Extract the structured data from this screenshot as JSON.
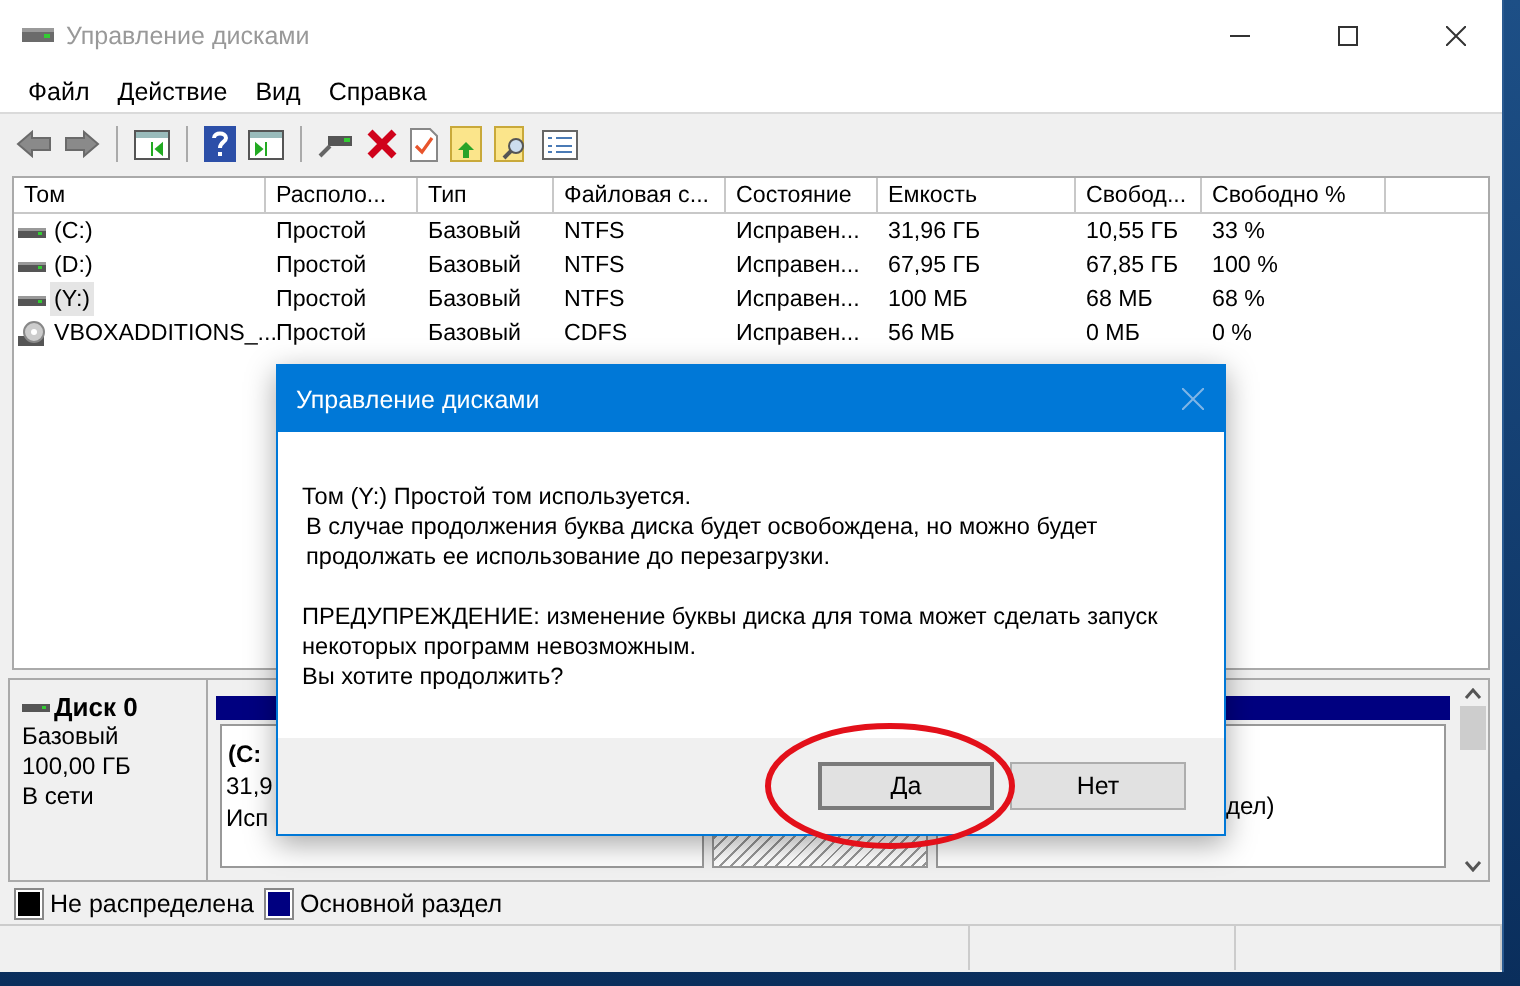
{
  "window": {
    "title": "Управление дисками"
  },
  "menu": [
    "Файл",
    "Действие",
    "Вид",
    "Справка"
  ],
  "table": {
    "columns": [
      "Том",
      "Располо...",
      "Тип",
      "Файловая с...",
      "Состояние",
      "Емкость",
      "Свобод...",
      "Свободно %"
    ],
    "rows": [
      {
        "kind": "disk",
        "selected": false,
        "cells": [
          "(C:)",
          "Простой",
          "Базовый",
          "NTFS",
          "Исправен...",
          "31,96 ГБ",
          "10,55 ГБ",
          "33 %"
        ]
      },
      {
        "kind": "disk",
        "selected": false,
        "cells": [
          "(D:)",
          "Простой",
          "Базовый",
          "NTFS",
          "Исправен...",
          "67,95 ГБ",
          "67,85 ГБ",
          "100 %"
        ]
      },
      {
        "kind": "disk",
        "selected": true,
        "cells": [
          "(Y:)",
          "Простой",
          "Базовый",
          "NTFS",
          "Исправен...",
          "100 МБ",
          "68 МБ",
          "68 %"
        ]
      },
      {
        "kind": "cd",
        "selected": false,
        "cells": [
          "VBOXADDITIONS_...",
          "Простой",
          "Базовый",
          "CDFS",
          "Исправен...",
          "56 МБ",
          "0 МБ",
          "0 %"
        ]
      }
    ]
  },
  "disk": {
    "name": "Диск 0",
    "lines": [
      "Базовый",
      "100,00 ГБ",
      "В сети"
    ],
    "partitions": [
      {
        "kind": "primary",
        "texts": [
          "(C:",
          "31,9",
          "Исп"
        ]
      },
      {
        "kind": "unallocated"
      },
      {
        "kind": "primary",
        "texts": [
          "дел)"
        ]
      }
    ]
  },
  "legend": [
    {
      "label": "Не распределена",
      "color": "#000000"
    },
    {
      "label": "Основной раздел",
      "color": "#000080"
    }
  ],
  "dialog": {
    "title": "Управление дисками",
    "paragraphs": [
      [
        "Том  (Y:) Простой том используется.",
        "В случае продолжения буква диска будет освобождена, но можно будет продолжать ее использование до перезагрузки."
      ],
      [
        "ПРЕДУПРЕЖДЕНИЕ: изменение буквы диска для тома может сделать запуск некоторых программ невозможным.",
        "Вы хотите продолжить?"
      ]
    ],
    "buttons": [
      {
        "label": "Да",
        "focused": true
      },
      {
        "label": "Нет",
        "focused": false
      }
    ]
  }
}
